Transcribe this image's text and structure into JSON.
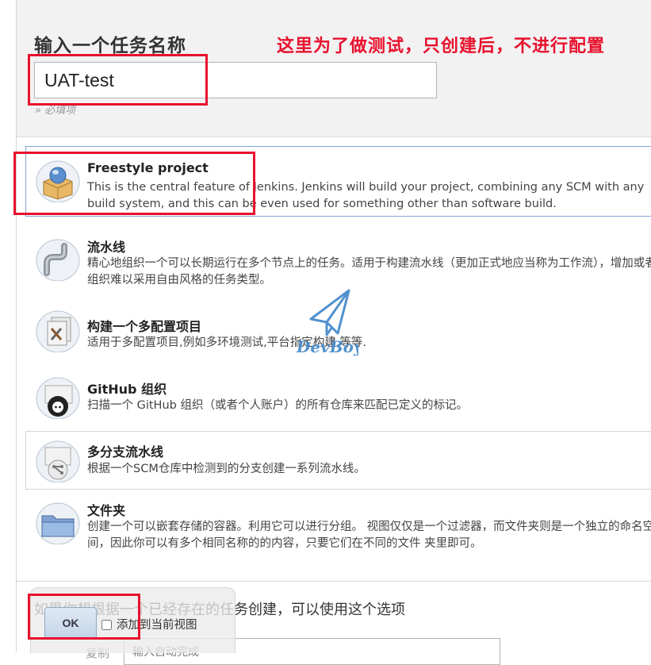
{
  "form": {
    "title": "输入一个任务名称",
    "name_value": "UAT-test",
    "required_hint": "» 必填项"
  },
  "annotation": {
    "note": "这里为了做测试，只创建后，不进行配置"
  },
  "job_types": [
    {
      "label": "Freestyle project",
      "description": "This is the central feature of Jenkins. Jenkins will build your project, combining any SCM with any build system, and this can be even used for something other than software build."
    },
    {
      "label": "流水线",
      "description": "精心地组织一个可以长期运行在多个节点上的任务。适用于构建流水线（更加正式地应当称为工作流），增加或者组织难以采用自由风格的任务类型。"
    },
    {
      "label": "构建一个多配置项目",
      "description": "适用于多配置项目,例如多环境测试,平台指定构建,等等."
    },
    {
      "label": "GitHub 组织",
      "description": "扫描一个 GitHub 组织（或者个人账户）的所有仓库来匹配已定义的标记。"
    },
    {
      "label": "多分支流水线",
      "description": "根据一个SCM仓库中检测到的分支创建一系列流水线。"
    },
    {
      "label": "文件夹",
      "description": "创建一个可以嵌套存储的容器。利用它可以进行分组。 视图仅仅是一个过滤器，而文件夹则是一个独立的命名空间，因此你可以有多个相同名称的的内容，只要它们在不同的文件 夹里即可。"
    }
  ],
  "copy": {
    "text": "如果你想根据一个已经存在的任务创建，可以使用这个选项",
    "label": "复制",
    "placeholder": "输入自动完成"
  },
  "footer": {
    "ok_label": "OK",
    "add_to_view_label": "添加到当前视图"
  },
  "watermark": {
    "text": "DevBoy"
  },
  "colors": {
    "annotation_red": "#e8112d",
    "selected_border": "#7fa7d8"
  }
}
